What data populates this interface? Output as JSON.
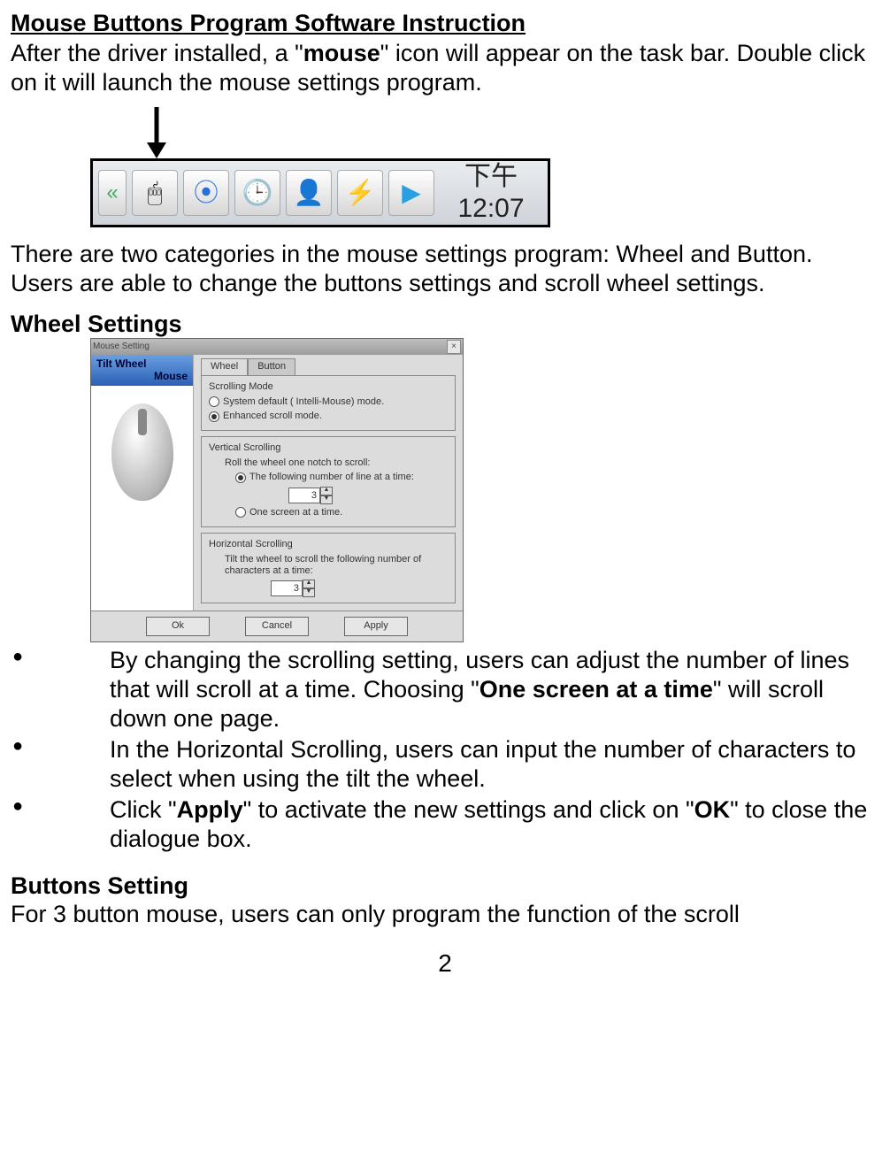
{
  "title": "Mouse Buttons Program Software Instruction",
  "intro_prefix": "After the driver installed, a \"",
  "intro_bold": "mouse",
  "intro_suffix": "\" icon will appear on the task bar. Double click on it will launch the mouse settings program.",
  "taskbar": {
    "chev": "«",
    "mouse_glyph": "🖱",
    "media_glyph": "⦿",
    "clock_glyph": "🕒",
    "user_glyph": "👤",
    "settings_glyph": "⚡",
    "play_glyph": "▶",
    "time_text": "下午 12:07"
  },
  "para2": "There are two categories in the mouse settings program: Wheel and Button. Users are able to change the buttons settings and scroll wheel settings.",
  "wheel_heading": "Wheel Settings",
  "dialog": {
    "titlebar": "Mouse Setting",
    "close": "×",
    "side_line1": "Tilt Wheel",
    "side_line2": "Mouse",
    "tab_wheel": "Wheel",
    "tab_button": "Button",
    "group1_title": "Scrolling Mode",
    "group1_opt1": "System default ( Intelli-Mouse) mode.",
    "group1_opt2": "Enhanced scroll mode.",
    "group2_title": "Vertical Scrolling",
    "group2_line": "Roll the wheel one notch to scroll:",
    "group2_opt1": "The following number of line at a time:",
    "group2_spin": "3",
    "group2_opt2": "One screen at a time.",
    "group3_title": "Horizontal Scrolling",
    "group3_line": "Tilt the wheel to scroll the following number of characters at a time:",
    "group3_spin": "3",
    "btn_ok": "Ok",
    "btn_cancel": "Cancel",
    "btn_apply": "Apply"
  },
  "bullets": {
    "b1_pre": "By changing the scrolling setting, users can adjust the number of lines that will scroll at a time. Choosing \"",
    "b1_bold": "One screen at a time",
    "b1_post": "\" will scroll down one page.",
    "b2": "In the Horizontal Scrolling, users can input the number of characters to select when using the tilt the wheel.",
    "b3_pre": "Click \"",
    "b3_bold1": "Apply",
    "b3_mid": "\" to activate the new settings and click on \"",
    "b3_bold2": "OK",
    "b3_post": "\" to close the dialogue box."
  },
  "buttons_heading": "Buttons Setting",
  "buttons_para": "For 3 button mouse, users can only program the function of the scroll",
  "page_number": "2"
}
